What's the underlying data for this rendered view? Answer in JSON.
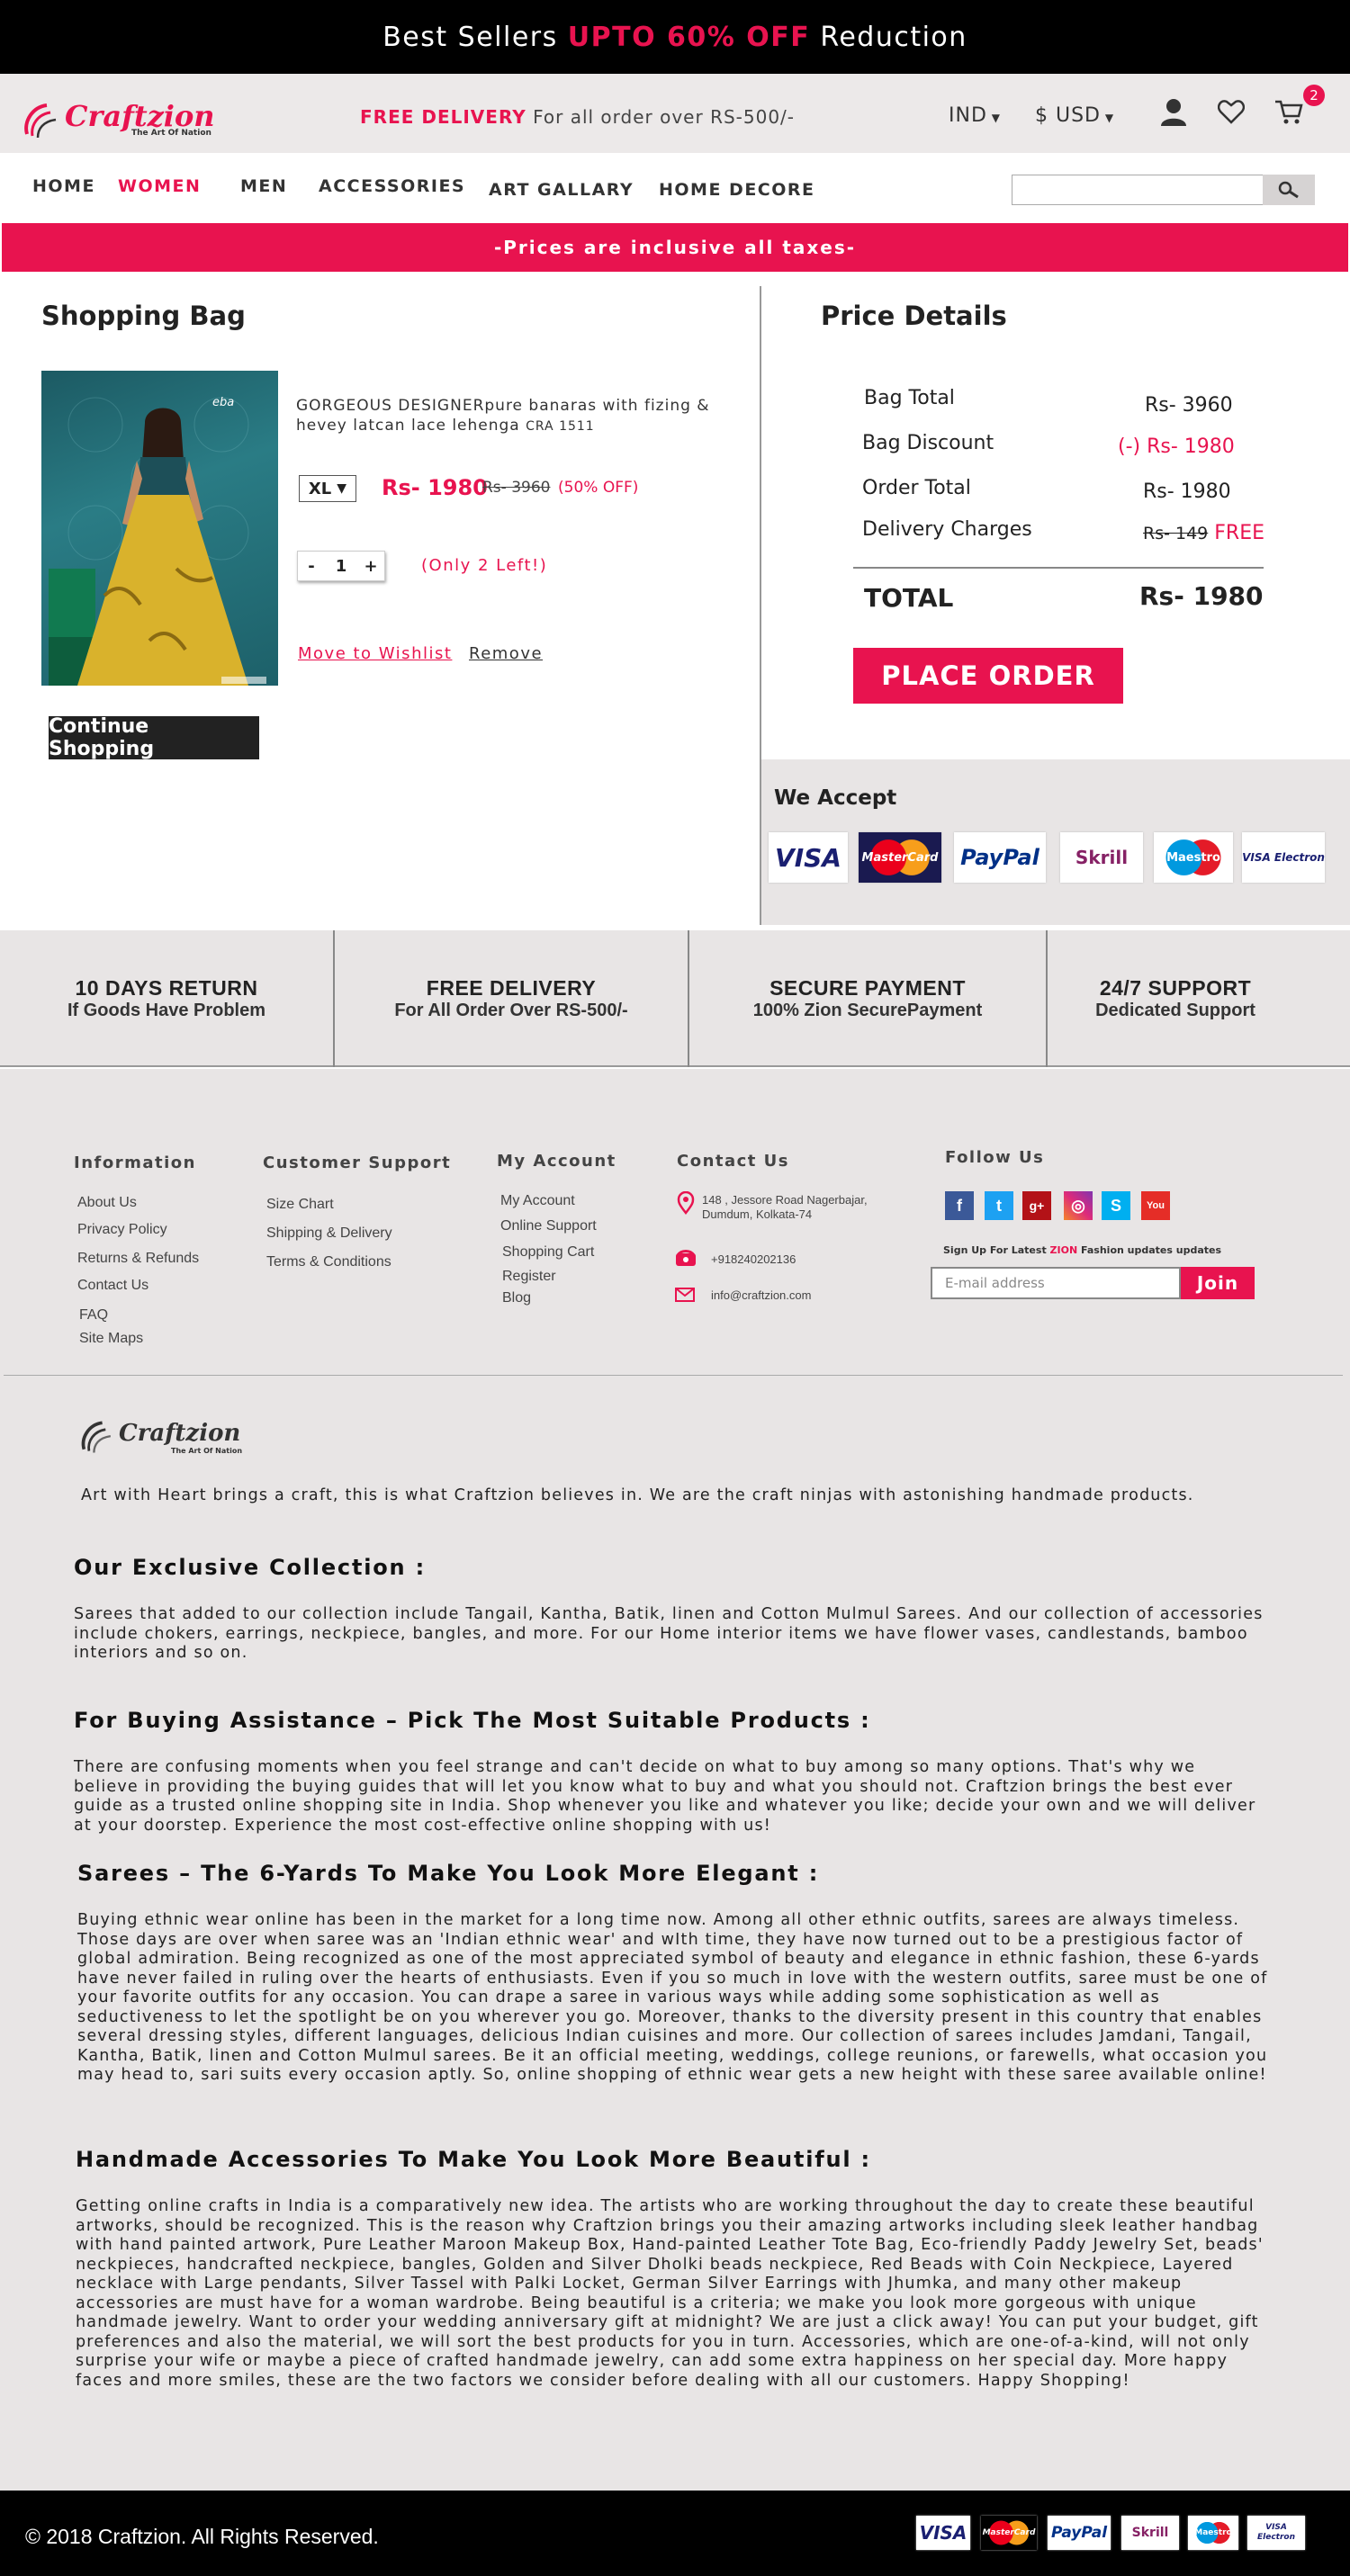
{
  "promo": {
    "pre": "Best Sellers ",
    "highlight": "UPTO 60% OFF",
    "post": " Reduction"
  },
  "header": {
    "logo": "Craftzion",
    "logo_tag": "The Art Of Nation",
    "delivery_bold": "FREE DELIVERY",
    "delivery_rest": " For all order over RS-500/-",
    "country": "IND",
    "currency": "$ USD",
    "cart_count": "2"
  },
  "nav": {
    "items": [
      "HOME",
      "WOMEN",
      "MEN",
      "ACCESSORIES",
      "ART GALLARY",
      "HOME DECORE"
    ],
    "active": "WOMEN"
  },
  "notice": "-Prices are inclusive all taxes-",
  "bag": {
    "title": "Shopping Bag",
    "product": {
      "name": "GORGEOUS DESIGNERpure banaras with fizing & hevey latcan lace lehenga",
      "code": "CRA 1511",
      "size": "XL",
      "price": "Rs- 1980",
      "old_price": "Rs- 3960",
      "off": "(50% OFF)",
      "qty": "1",
      "only_left": "(Only 2 Left!)",
      "wishlist": "Move to Wishlist",
      "remove": "Remove",
      "image_brand": "eba"
    },
    "continue": "Continue Shopping"
  },
  "price_details": {
    "title": "Price Details",
    "rows": [
      {
        "label": "Bag Total",
        "value": "Rs- 3960"
      },
      {
        "label": "Bag Discount",
        "value": "(-) Rs- 1980"
      },
      {
        "label": "Order Total",
        "value": "Rs- 1980"
      },
      {
        "label": "Delivery Charges",
        "value_strike": "Rs- 149",
        "value_free": "FREE"
      }
    ],
    "total_label": "TOTAL",
    "total_value": "Rs- 1980",
    "place_order": "PLACE ORDER"
  },
  "we_accept": {
    "title": "We Accept",
    "cards": [
      "VISA",
      "MasterCard",
      "PayPal",
      "Skrill",
      "Maestro",
      "VISA Electron"
    ]
  },
  "features": [
    {
      "title": "10 DAYS RETURN",
      "sub": "If Goods Have Problem"
    },
    {
      "title": "FREE DELIVERY",
      "sub": "For All Order Over RS-500/-"
    },
    {
      "title": "SECURE PAYMENT",
      "sub": "100% Zion SecurePayment"
    },
    {
      "title": "24/7 SUPPORT",
      "sub": "Dedicated Support"
    }
  ],
  "footer": {
    "information": {
      "title": "Information",
      "links": [
        "About Us",
        "Privacy Policy",
        "Returns & Refunds",
        "Contact Us",
        "FAQ",
        "Site Maps"
      ]
    },
    "support": {
      "title": "Customer Support",
      "links": [
        "Size Chart",
        "Shipping & Delivery",
        "Terms & Conditions"
      ]
    },
    "account": {
      "title": "My Account",
      "links": [
        "My Account",
        "Online Support",
        "Shopping Cart",
        "Register",
        "Blog"
      ]
    },
    "contact": {
      "title": "Contact Us",
      "address": "148 , Jessore Road Nagerbajar, Dumdum, Kolkata-74",
      "phone": "+918240202136",
      "email": "info@craftzion.com"
    },
    "follow": {
      "title": "Follow Us",
      "signup_pre": "Sign Up For Latest ",
      "signup_brand": "ZION",
      "signup_post": " Fashion updates updates",
      "email_placeholder": "E-mail address",
      "join": "Join"
    }
  },
  "about": {
    "intro": "Art with Heart brings a craft, this is what Craftzion believes in. We are the craft ninjas with astonishing handmade products.",
    "sections": [
      {
        "title": "Our Exclusive Collection :",
        "text": "Sarees that added to our collection include Tangail, Kantha, Batik, linen and Cotton Mulmul Sarees. And our collection of accessories include chokers, earrings, neckpiece, bangles, and more. For our Home interior items we have flower vases, candlestands, bamboo interiors and so on."
      },
      {
        "title": "For Buying Assistance – Pick The Most Suitable Products :",
        "text": "There are confusing moments when you feel strange and can't decide on what to buy among so many options. That's why we believe in providing the buying guides that will let you know what to buy and what you should not. Craftzion brings the best ever guide as a trusted online shopping site in India. Shop whenever you like and whatever you like; decide your own and we will deliver at your doorstep. Experience the most cost-effective online shopping with us!"
      },
      {
        "title": "Sarees – The 6-Yards To Make You Look More Elegant :",
        "text": "Buying ethnic wear online has been in the market for a long time now. Among all other ethnic outfits, sarees are always timeless. Those days are over when saree was an 'Indian ethnic wear' and wIth time, they have now turned out to be a prestigious factor of global admiration. Being recognized as one of the most appreciated symbol of beauty and elegance in ethnic fashion, these 6-yards have never failed in ruling over the hearts of enthusiasts. Even if you so much in love with the western outfits, saree must be one of your favorite outfits for any occasion. You can drape a saree in various ways while adding some sophistication as well as seductiveness to let the spotlight be on you wherever you go. Moreover, thanks to the diversity present in this country that enables several dressing styles, different languages, delicious Indian cuisines and more. Our collection of sarees includes Jamdani, Tangail, Kantha, Batik, linen and Cotton Mulmul sarees. Be it an official meeting, weddings, college reunions, or farewells, what occasion you may head to, sari suits every occasion aptly. So, online shopping of ethnic wear gets a new height with these saree available online!"
      },
      {
        "title": "Handmade Accessories To Make You Look More Beautiful :",
        "text": "Getting online crafts in India is a comparatively new idea. The artists who are working throughout the day to create these beautiful artworks, should be recognized. This is the reason why Craftzion brings you their amazing artworks including sleek leather handbag with hand painted artwork, Pure Leather Maroon Makeup Box, Hand-painted Leather Tote Bag, Eco-friendly Paddy Jewelry Set, beads' neckpieces, handcrafted neckpiece, bangles, Golden and Silver Dholki beads neckpiece, Red Beads with Coin Neckpiece, Layered necklace with Large pendants, Silver Tassel with Palki Locket, German Silver Earrings with Jhumka, and many other makeup accessories are must have for a woman wardrobe. Being beautiful is a criteria; we make you look more gorgeous with unique handmade jewelry. Want to order your wedding anniversary gift at midnight? We are just a click away! You can put your budget, gift preferences and also the material, we will sort the best products for you in turn. Accessories, which are one-of-a-kind, will not only surprise your wife or maybe a piece of crafted handmade jewelry, can add some extra happiness on her special day. More happy faces and more smiles, these are the two factors we consider before dealing with all our customers. Happy Shopping!"
      }
    ]
  },
  "copyright": "© 2018 Craftzion. All Rights Reserved.",
  "colors": {
    "accent": "#e8134f",
    "dark": "#000000",
    "panel": "#e8e5e5"
  }
}
